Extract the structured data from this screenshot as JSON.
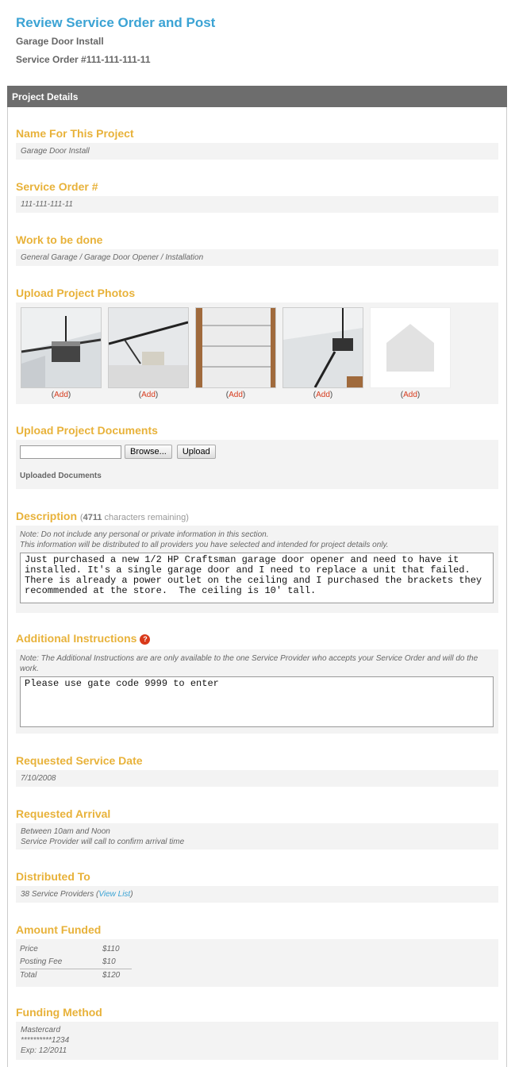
{
  "header": {
    "title": "Review Service Order and Post",
    "project_name": "Garage Door Install",
    "order_number": "Service Order #111-111-111-11"
  },
  "panel": {
    "title": "Project Details"
  },
  "name_section": {
    "heading": "Name For This Project",
    "value": "Garage Door Install"
  },
  "order_section": {
    "heading": "Service Order #",
    "value": "111-111-111-11"
  },
  "work_section": {
    "heading": "Work to be done",
    "value": "General Garage / Garage Door Opener / Installation"
  },
  "photos_section": {
    "heading": "Upload Project Photos",
    "photos": [
      {
        "add_label": "Add"
      },
      {
        "add_label": "Add"
      },
      {
        "add_label": "Add"
      },
      {
        "add_label": "Add"
      },
      {
        "add_label": "Add"
      }
    ]
  },
  "documents_section": {
    "heading": "Upload Project Documents",
    "browse_label": "Browse...",
    "upload_label": "Upload",
    "uploaded_label": "Uploaded Documents"
  },
  "description_section": {
    "heading": "Description",
    "remaining_count": "4711",
    "remaining_text": "characters remaining",
    "note_line1": "Note: Do not include any personal or private information in this section.",
    "note_line2": "This information will be distributed to all providers you have selected and intended for project details only.",
    "text": "Just purchased a new 1/2 HP Craftsman garage door opener and need to have it installed. It's a single garage door and I need to replace a unit that failed. There is already a power outlet on the ceiling and I purchased the brackets they recommended at the store.  The ceiling is 10' tall."
  },
  "instructions_section": {
    "heading": "Additional Instructions",
    "help_glyph": "?",
    "note": "Note: The Additional Instructions are are only available to the one Service Provider who accepts your Service Order and will do the work.",
    "text": "Please use gate code 9999 to enter"
  },
  "date_section": {
    "heading": "Requested Service Date",
    "value": "7/10/2008"
  },
  "arrival_section": {
    "heading": "Requested Arrival",
    "line1": "Between 10am and Noon",
    "line2": "Service Provider will call to confirm arrival time"
  },
  "distributed_section": {
    "heading": "Distributed To",
    "value": "38 Service Providers",
    "link": "View List"
  },
  "amount_section": {
    "heading": "Amount Funded",
    "rows": [
      {
        "label": "Price",
        "value": "$110"
      },
      {
        "label": "Posting Fee",
        "value": "$10"
      },
      {
        "label": "Total",
        "value": "$120"
      }
    ]
  },
  "funding_section": {
    "heading": "Funding Method",
    "card": "Mastercard",
    "number": "**********1234",
    "expiry": "Exp: 12/2011"
  },
  "colors": {
    "title_blue": "#3ba3d4",
    "heading_gold": "#e8b23a",
    "panel_header": "#6d6d6d",
    "add_red": "#d63b1d"
  }
}
